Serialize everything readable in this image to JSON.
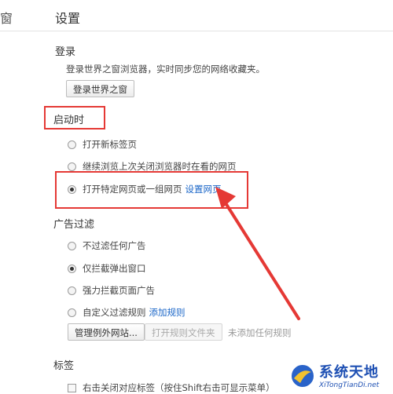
{
  "sidebar_fragment": "窗",
  "page_title": "设置",
  "login": {
    "title": "登录",
    "description": "登录世界之窗浏览器，实时同步您的网络收藏夹。",
    "button": "登录世界之窗"
  },
  "startup": {
    "title": "启动时",
    "options": [
      {
        "label": "打开新标签页",
        "selected": false
      },
      {
        "label": "继续浏览上次关闭浏览器时在看的网页",
        "selected": false
      },
      {
        "label": "打开特定网页或一组网页",
        "selected": true,
        "link": "设置网页"
      }
    ]
  },
  "adblock": {
    "title": "广告过滤",
    "options": [
      {
        "label": "不过滤任何广告",
        "selected": false
      },
      {
        "label": "仅拦截弹出窗口",
        "selected": true
      },
      {
        "label": "强力拦截页面广告",
        "selected": false
      },
      {
        "label": "自定义过滤规则",
        "selected": false,
        "link": "添加规则"
      }
    ],
    "manage_button": "管理例外网站...",
    "open_rules_button": "打开规则文件夹",
    "no_rules_text": "未添加任何规则"
  },
  "tabs": {
    "title": "标签",
    "close_on_right_click": "右击关闭对应标签（按住Shift右击可显示菜单）"
  },
  "logo": {
    "name": "系统天地",
    "url": "XiTongTianDi.net"
  },
  "annotation_color": "#e53935"
}
